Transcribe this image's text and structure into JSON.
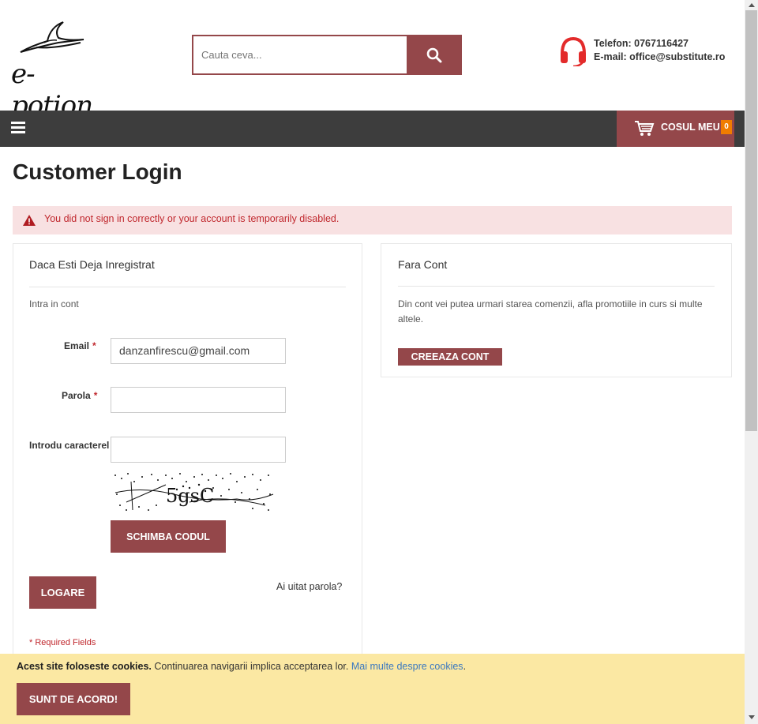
{
  "header": {
    "logo_text": "e-potion",
    "search": {
      "placeholder": "Cauta ceva..."
    },
    "contact": {
      "phone_label": "Telefon: 0767116427",
      "email_label": "E-mail: office@substitute.ro"
    }
  },
  "nav": {
    "cart_label": "COSUL MEU",
    "cart_count": "0"
  },
  "page": {
    "title": "Customer Login",
    "alert": "You did not sign in correctly or your account is temporarily disabled."
  },
  "login": {
    "title": "Daca Esti Deja Inregistrat",
    "subtitle": "Intra in cont",
    "email_label": "Email",
    "email_value": "danzanfirescu@gmail.com",
    "password_label": "Parola",
    "password_value": "",
    "captcha_label": "Introdu caracterel",
    "captcha_value": "",
    "captcha_text": "5gsC",
    "change_code_label": "SCHIMBA CODUL",
    "submit_label": "LOGARE",
    "forgot_label": "Ai uitat parola?",
    "required_note": "* Required Fields",
    "required_marker": "*"
  },
  "register": {
    "title": "Fara Cont",
    "description": "Din cont vei putea urmari starea comenzii, afla promotiile in curs si multe altele.",
    "button_label": "CREEAZA CONT"
  },
  "cookie": {
    "bold_text": "Acest site foloseste cookies.",
    "text": " Continuarea navigarii implica acceptarea lor. ",
    "link_text": "Mai multe despre cookies",
    "period": ".",
    "button_label": "SUNT DE ACORD!"
  },
  "colors": {
    "brand": "#94474a",
    "nav_bg": "#3d3d3d",
    "alert_bg": "#f8e1e2",
    "cookie_bg": "#fbe8a3",
    "badge": "#f07c00"
  }
}
